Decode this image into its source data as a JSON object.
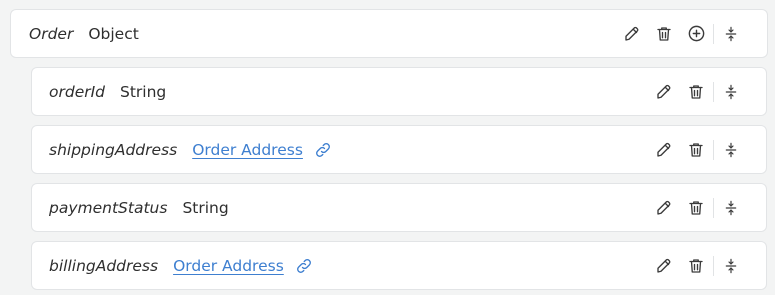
{
  "root": {
    "name": "Order",
    "type": "Object"
  },
  "fields": [
    {
      "name": "orderId",
      "type": "String"
    },
    {
      "name": "shippingAddress",
      "link": "Order Address"
    },
    {
      "name": "paymentStatus",
      "type": "String"
    },
    {
      "name": "billingAddress",
      "link": "Order Address"
    }
  ],
  "icons": {
    "edit": "pencil-icon",
    "delete": "trash-icon",
    "add": "plus-circle-icon",
    "reorder": "vertical-resize-icon",
    "link": "link-icon"
  },
  "colors": {
    "link": "#3e7fd0",
    "background": "#f3f4f4",
    "card": "#ffffff"
  }
}
